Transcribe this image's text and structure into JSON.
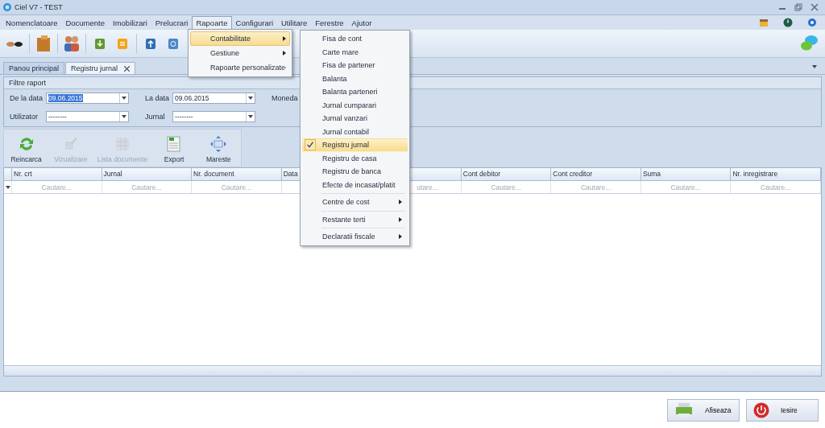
{
  "window": {
    "title": "Ciel V7 - TEST"
  },
  "menu_bar": [
    {
      "label": "Nomenclatoare",
      "selected": false
    },
    {
      "label": "Documente",
      "selected": false
    },
    {
      "label": "Imobilizari",
      "selected": false
    },
    {
      "label": "Prelucrari",
      "selected": false
    },
    {
      "label": "Rapoarte",
      "selected": true
    },
    {
      "label": "Configurari",
      "selected": false
    },
    {
      "label": "Utilitare",
      "selected": false
    },
    {
      "label": "Ferestre",
      "selected": false
    },
    {
      "label": "Ajutor",
      "selected": false
    }
  ],
  "rapoarte_menu": [
    {
      "label": "Contabilitate",
      "selected": true
    },
    {
      "label": "Gestiune",
      "selected": false
    },
    {
      "label": "Rapoarte personalizate",
      "selected": false
    }
  ],
  "submenu": [
    {
      "kind": "item",
      "label": "Fisa de cont",
      "checked": false,
      "selected": false
    },
    {
      "kind": "item",
      "label": "Carte mare",
      "checked": false,
      "selected": false
    },
    {
      "kind": "item",
      "label": "Fisa de partener",
      "checked": false,
      "selected": false
    },
    {
      "kind": "item",
      "label": "Balanta",
      "checked": false,
      "selected": false
    },
    {
      "kind": "item",
      "label": "Balanta parteneri",
      "checked": false,
      "selected": false
    },
    {
      "kind": "item",
      "label": "Jurnal cumparari",
      "checked": false,
      "selected": false
    },
    {
      "kind": "item",
      "label": "Jurnal vanzari",
      "checked": false,
      "selected": false
    },
    {
      "kind": "item",
      "label": "Jurnal contabil",
      "checked": false,
      "selected": false
    },
    {
      "kind": "item",
      "label": "Registru jurnal",
      "checked": true,
      "selected": true
    },
    {
      "kind": "item",
      "label": "Registru de casa",
      "checked": false,
      "selected": false
    },
    {
      "kind": "item",
      "label": "Registru de banca",
      "checked": false,
      "selected": false
    },
    {
      "kind": "item",
      "label": "Efecte de incasat/platit",
      "checked": false,
      "selected": false
    },
    {
      "kind": "submenu",
      "label": "Centre de cost",
      "checked": false,
      "selected": false
    },
    {
      "kind": "submenu",
      "label": "Restante terti",
      "checked": false,
      "selected": false
    },
    {
      "kind": "submenu",
      "label": "Declaratii fiscale",
      "checked": false,
      "selected": false
    }
  ],
  "tabs": [
    {
      "label": "Panou principal",
      "selected": false
    },
    {
      "label": "Registru jurnal",
      "selected": true
    }
  ],
  "filter_panel": {
    "title": "Filtre raport",
    "date_fields": [
      {
        "label": "De la data",
        "value": "09.06.2015"
      },
      {
        "label": "La data",
        "value": "09.06.2015"
      },
      {
        "label": "Moneda"
      }
    ],
    "filter_fields": [
      {
        "label": "Utilizator",
        "value": "--------"
      },
      {
        "label": "Jurnal",
        "value": "--------"
      }
    ]
  },
  "actions": [
    {
      "label": "Reincarca",
      "disabled": false
    },
    {
      "label": "Vizualizare",
      "disabled": true
    },
    {
      "label": "Lista documente",
      "disabled": true
    },
    {
      "label": "Export",
      "disabled": false
    },
    {
      "label": "Mareste",
      "disabled": false
    }
  ],
  "grid": {
    "columns": [
      {
        "header": "Nr. crt",
        "filter": "Cautare..."
      },
      {
        "header": "Jurnal",
        "filter": "Cautare..."
      },
      {
        "header": "Nr. document",
        "filter": "Cautare..."
      },
      {
        "header": "Data"
      },
      {
        "filter": "utare..."
      },
      {
        "header": "Cont debitor",
        "filter": "Cautare..."
      },
      {
        "header": "Cont creditor",
        "filter": "Cautare..."
      },
      {
        "header": "Suma",
        "filter": "Cautare..."
      },
      {
        "header": "Nr. inregistrare",
        "filter": "Cautare..."
      }
    ]
  },
  "buttons": [
    {
      "kind": "print",
      "label": "Afiseaza"
    },
    {
      "kind": "power",
      "label": "Iesire"
    }
  ]
}
